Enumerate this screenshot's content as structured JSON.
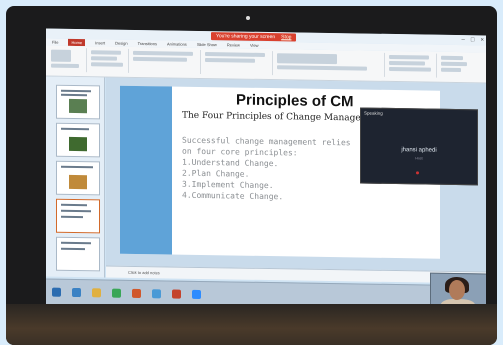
{
  "window": {
    "share_banner": "You're sharing your screen",
    "stop_label": "Stop",
    "min": "–",
    "max": "□",
    "close": "×"
  },
  "tabs": [
    "File",
    "Home",
    "Insert",
    "Design",
    "Transitions",
    "Animations",
    "Slide Show",
    "Review",
    "View"
  ],
  "slide": {
    "title": "Principles of CM",
    "subtitle": "The Four Principles of Change Management",
    "body_lines": [
      "Successful change management relies",
      "on four core principles:",
      "1.Understand Change.",
      "2.Plan Change.",
      "3.Implement Change.",
      "4.Communicate Change."
    ]
  },
  "notes": {
    "placeholder": "Click to add notes"
  },
  "speaking_panel": {
    "header": "Speaking",
    "name": "jhansi aphedi",
    "role": "Host"
  },
  "taskbar": {
    "icons": [
      {
        "name": "start-icon",
        "color": "#2b6cb0"
      },
      {
        "name": "ie-icon",
        "color": "#3b82c4"
      },
      {
        "name": "explorer-icon",
        "color": "#e0b040"
      },
      {
        "name": "chrome-icon",
        "color": "#3aa657"
      },
      {
        "name": "media-icon",
        "color": "#d0582c"
      },
      {
        "name": "app-icon",
        "color": "#4a9ad6"
      },
      {
        "name": "powerpoint-icon",
        "color": "#c4432b"
      },
      {
        "name": "zoom-icon",
        "color": "#2d8cff"
      }
    ]
  }
}
